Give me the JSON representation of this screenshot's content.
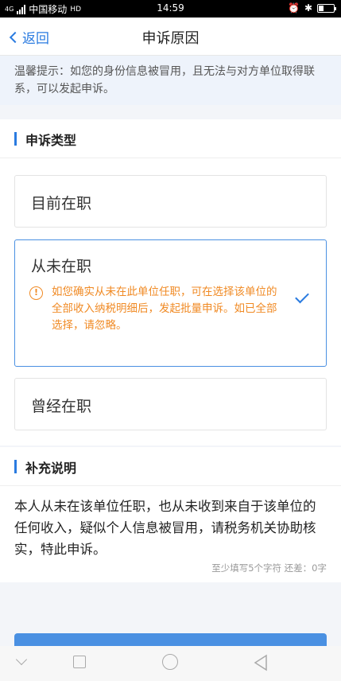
{
  "status_bar": {
    "network": "4G",
    "carrier": "中国移动",
    "hd": "HD",
    "time": "14:59",
    "battery_level": 0.35
  },
  "nav": {
    "back_label": "返回",
    "title": "申诉原因"
  },
  "tip": {
    "text": "温馨提示：如您的身份信息被冒用，且无法与对方单位取得联系，可以发起申诉。"
  },
  "appeal_type": {
    "heading": "申诉类型",
    "options": [
      {
        "label": "目前在职",
        "selected": false
      },
      {
        "label": "从未在职",
        "selected": true,
        "note": "如您确实从未在此单位任职，可在选择该单位的全部收入纳税明细后，发起批量申诉。如已全部选择，请忽略。"
      },
      {
        "label": "曾经在职",
        "selected": false
      }
    ]
  },
  "supplement": {
    "heading": "补充说明",
    "text": "本人从未在该单位任职，也从未收到来自于该单位的任何收入，疑似个人信息被冒用，请税务机关协助核实，特此申诉。",
    "counter": "至少填写5个字符 还差：0字"
  },
  "colors": {
    "accent": "#2a7be0",
    "warning": "#f08a24",
    "button": "#4a90e2"
  }
}
